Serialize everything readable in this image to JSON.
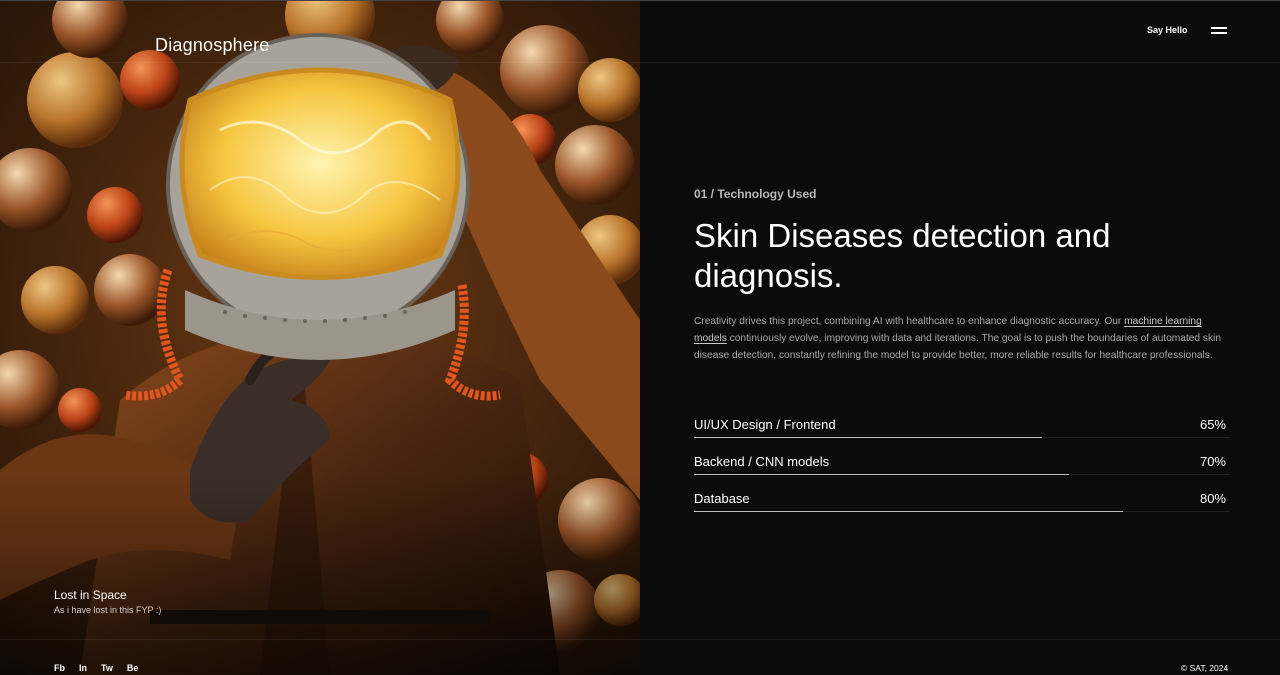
{
  "brand": "Diagnosphere",
  "header": {
    "say_hello": "Say Hello",
    "menu_icon": "hamburger-menu-icon"
  },
  "hero": {
    "caption_title": "Lost in Space",
    "caption_subtitle": "As i have lost in this FYP :)",
    "image_desc": "astronaut-with-glowing-visor"
  },
  "socials": [
    "Fb",
    "In",
    "Tw",
    "Be"
  ],
  "section": {
    "kicker": "01 / Technology Used",
    "headline": "Skin Diseases detection and diagnosis.",
    "description_before": "Creativity drives this project, combining AI with healthcare to enhance diagnostic accuracy. Our ",
    "description_link": "machine learning models",
    "description_after": " continuously evolve, improving with data and iterations. The goal is to push the boundaries of automated skin disease detection, constantly refining the model to provide better, more reliable results for healthcare professionals."
  },
  "skills": [
    {
      "label": "UI/UX Design / Frontend",
      "percent_text": "65%",
      "value": 0.65
    },
    {
      "label": "Backend / CNN models",
      "percent_text": "70%",
      "value": 0.7
    },
    {
      "label": "Database",
      "percent_text": "80%",
      "value": 0.8
    }
  ],
  "footer": {
    "copyright": "© SAT, 2024"
  },
  "colors": {
    "background": "#0b0b0b",
    "text": "#ffffff",
    "muted": "#a8a8a8",
    "bar_fill": "#bdbdbd",
    "accent_orange": "#e0561e"
  }
}
